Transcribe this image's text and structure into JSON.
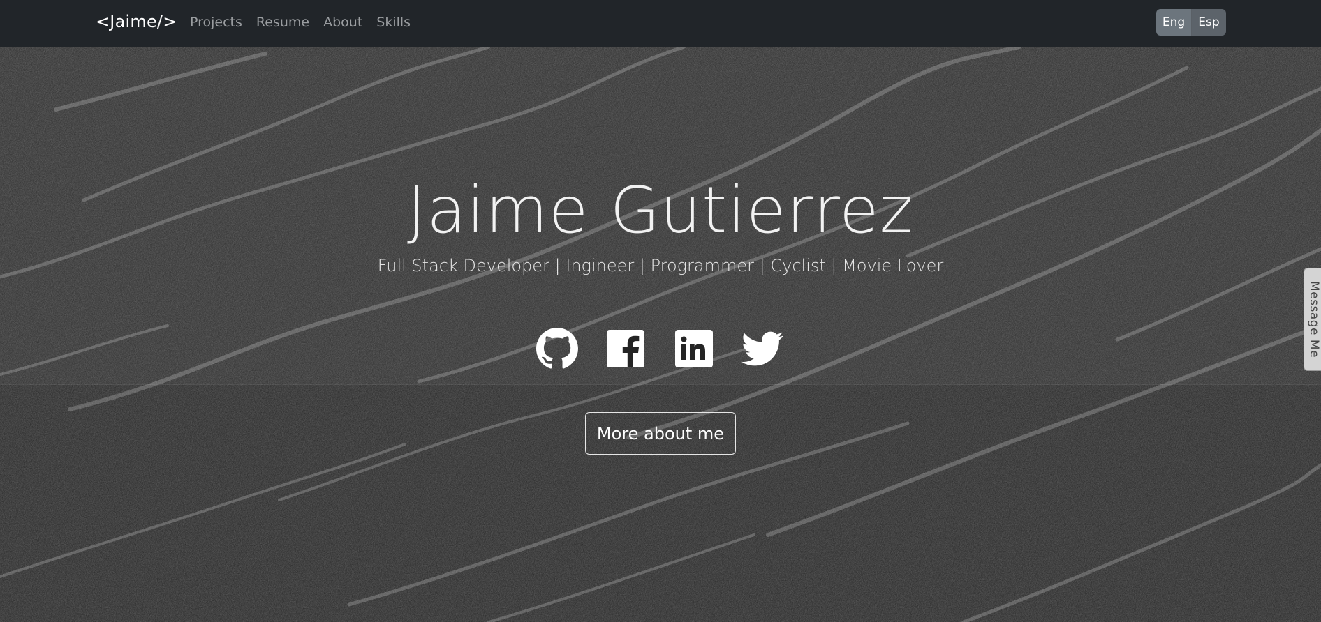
{
  "navbar": {
    "brand": "<Jaime/>",
    "links": [
      "Projects",
      "Resume",
      "About",
      "Skills"
    ],
    "languages": [
      "Eng",
      "Esp"
    ]
  },
  "hero": {
    "title": "Jaime Gutierrez",
    "subtitle": "Full Stack Developer | Ingineer | Programmer | Cyclist | Movie Lover",
    "social": [
      {
        "icon": "github-icon"
      },
      {
        "icon": "facebook-icon"
      },
      {
        "icon": "linkedin-icon"
      },
      {
        "icon": "twitter-icon"
      }
    ],
    "more_button": "More about me"
  },
  "message_tab": "Message Me",
  "colors": {
    "navbar_bg": "#212529",
    "nav_link": "#9a9da0",
    "lang_btn": "#6c757d"
  }
}
